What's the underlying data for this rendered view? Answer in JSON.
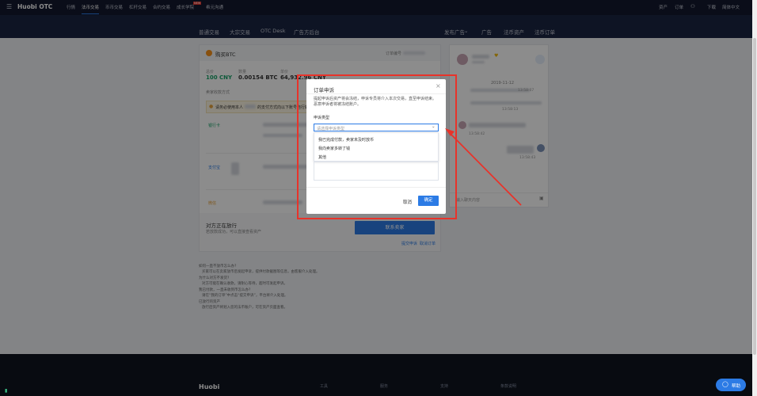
{
  "topnav": {
    "logo": "Huobi OTC",
    "items": [
      "行情",
      "法币交易",
      "币币交易",
      "杠杆交易",
      "合约交易",
      "成长学院",
      "希元沟通"
    ],
    "new_badge": "NEW",
    "right": [
      "资产",
      "订单",
      "下载",
      "简体中文"
    ]
  },
  "subnav": {
    "left": [
      "普通交易",
      "大宗交易",
      "OTC Desk",
      "广告方后台"
    ],
    "right": [
      "发布广告",
      "广告",
      "法币资产",
      "法币订单"
    ]
  },
  "order": {
    "title": "购买BTC",
    "order_no_label": "订单编号",
    "total_label": "总价",
    "total_value": "100 CNY",
    "qty_label": "数量",
    "qty_value": "0.00154 BTC",
    "price_label": "单价",
    "price_value": "64,932.96 CNY",
    "pay_method_label": "卖家收款方式",
    "warning_prefix": "请务必使用本人",
    "warning_suffix": "的支付方式向以下账号自行转账",
    "method_1": "银行卡",
    "method_2": "支付宝",
    "method_3": "微信",
    "status_title": "对方正在放行",
    "status_desc": "若放款成功，可以直接查看资产",
    "contact_button": "联系卖家",
    "appeal_link": "提交申诉",
    "cancel_link": "取消订单"
  },
  "chat": {
    "date": "2019-11-12",
    "time_1": "13:58:07",
    "time_2": "13:58:13",
    "time_3": "13:58:42",
    "time_4": "13:58:43",
    "input_placeholder": "输入聊天内容"
  },
  "notes": {
    "items": [
      "如何一直不放币怎么办?",
      "买家可以在卖家放币后发起申诉，提供付款截图等信息，由客服介入处理。",
      "为什么对方不发货?",
      "对方可能在确认收款，请耐心等待，超时可发起申诉。",
      "我已付款，一直未收到币怎么办?",
      "请在“我的订单”中点击“提交申诉”，平台将介入处理。",
      "已放行的资产",
      "放行后资产将划入您的法币账户，可在资产页面查看。"
    ]
  },
  "footer": {
    "logo": "Huobi",
    "columns": [
      "工具",
      "服务",
      "支持",
      "条款说明"
    ]
  },
  "dialog": {
    "title": "订单申诉",
    "desc": "提起申诉后资产将会冻结，申诉专员将介入本次交易，直至申诉结束。恶意申诉者将被冻结账户。",
    "type_label": "申诉类型",
    "select_placeholder": "请选择申诉类型",
    "options": [
      "我已完成付款，卖家未及时放币",
      "我向卖家多转了钱",
      "其他"
    ],
    "cancel_label": "取消",
    "confirm_label": "确定",
    "close_glyph": "×"
  },
  "support": {
    "label": "帮助"
  },
  "colors": {
    "accent": "#2c7be5",
    "highlight": "#e8332a",
    "nav": "#13192e",
    "success": "#1aa46a"
  }
}
